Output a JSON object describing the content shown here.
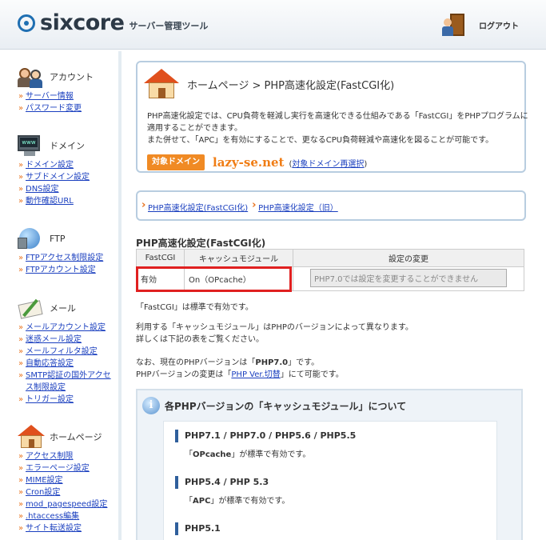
{
  "header": {
    "logo_text": "sixcore",
    "logo_sub": "サーバー管理ツール",
    "logout_label": "ログアウト"
  },
  "sidebar": {
    "groups": [
      {
        "label": "アカウント",
        "icon": "account-icon",
        "items": [
          "サーバー情報",
          "パスワード変更"
        ]
      },
      {
        "label": "ドメイン",
        "icon": "domain-icon",
        "items": [
          "ドメイン設定",
          "サブドメイン設定",
          "DNS設定",
          "動作確認URL"
        ]
      },
      {
        "label": "FTP",
        "icon": "ftp-icon",
        "items": [
          "FTPアクセス制限設定",
          "FTPアカウント設定"
        ]
      },
      {
        "label": "メール",
        "icon": "mail-icon",
        "items": [
          "メールアカウント設定",
          "迷惑メール設定",
          "メールフィルタ設定",
          "自動応答設定",
          "SMTP認証の国外アクセス制限設定",
          "トリガー設定"
        ]
      },
      {
        "label": "ホームページ",
        "icon": "home-icon",
        "items": [
          "アクセス制限",
          "エラーページ設定",
          "MIME設定",
          "Cron設定",
          "mod_pagespeed設定",
          ".htaccess編集",
          "サイト転送設定"
        ]
      }
    ]
  },
  "page": {
    "title": "ホームページ > PHP高速化設定(FastCGI化)",
    "desc_line1": "PHP高速化設定では、CPU負荷を軽減し実行を高速化できる仕組みである「FastCGI」をPHPプログラムに適用することができます。",
    "desc_line2": "また併せて、「APC」を有効にすることで、更なるCPU負荷軽減や高速化を図ることが可能です。",
    "target_badge": "対象ドメイン",
    "target_domain": "lazy-se.net",
    "target_link_open": "(",
    "target_link": "対象ドメイン再選択",
    "target_link_close": ")"
  },
  "nav": {
    "links": [
      "PHP高速化設定(FastCGI化)",
      "PHP高速化設定（旧）"
    ]
  },
  "section": {
    "title": "PHP高速化設定(FastCGI化)",
    "table": {
      "headers": [
        "FastCGI",
        "キャッシュモジュール",
        "設定の変更"
      ],
      "row": [
        "有効",
        "On（OPcache）",
        "PHP7.0では設定を変更することができません"
      ]
    },
    "note1": "「FastCGI」は標準で有効です。",
    "para1_line1": "利用する「キャッシュモジュール」はPHPのバージョンによって異なります。",
    "para1_line2": "詳しくは下記の表をご覧ください。",
    "para2_prefix": "なお、現在のPHPバージョンは「",
    "para2_version": "PHP7.0",
    "para2_suffix": "」です。",
    "para3_prefix": "PHPバージョンの変更は「",
    "para3_link": "PHP Ver.切替",
    "para3_suffix": "」にて可能です。"
  },
  "info": {
    "title": "各PHPバージョンの「キャッシュモジュール」について",
    "versions": [
      {
        "label": "PHP7.1 / PHP7.0 / PHP5.6 / PHP5.5",
        "note_prefix": "「",
        "note_module": "OPcache",
        "note_suffix": "」が標準で有効です。"
      },
      {
        "label": "PHP5.4 / PHP 5.3",
        "note_prefix": "「",
        "note_module": "APC",
        "note_suffix": "」が標準で有効です。"
      },
      {
        "label": "PHP5.1"
      }
    ]
  }
}
